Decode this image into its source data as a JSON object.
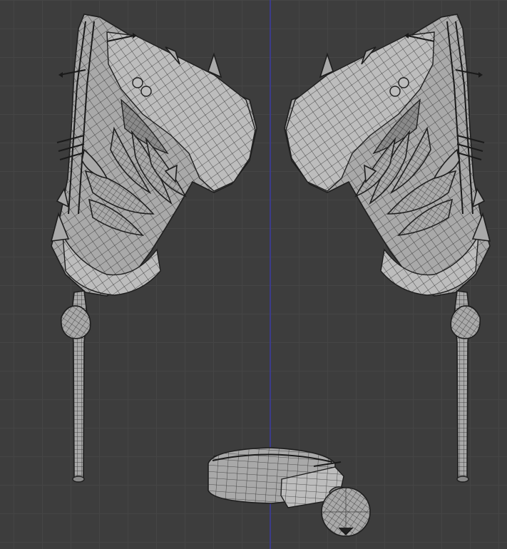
{
  "viewport": {
    "background": "#3d3d3d",
    "grid_color": "#454545",
    "axis_color": "#3a3aa8",
    "mesh_color": "#a9a9a9",
    "wire_color": "#2a2a2a"
  },
  "objects": [
    {
      "id": "left-wing",
      "kind": "mesh"
    },
    {
      "id": "right-wing",
      "kind": "mesh"
    },
    {
      "id": "left-rod",
      "kind": "mesh"
    },
    {
      "id": "right-rod",
      "kind": "mesh"
    },
    {
      "id": "bracelet",
      "kind": "mesh"
    },
    {
      "id": "charm-ball",
      "kind": "mesh"
    }
  ]
}
